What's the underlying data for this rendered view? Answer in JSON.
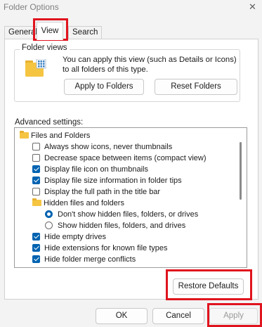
{
  "window": {
    "title": "Folder Options",
    "close_glyph": "✕"
  },
  "tabs": [
    "General",
    "View",
    "Search"
  ],
  "folder_views": {
    "label": "Folder views",
    "description": "You can apply this view (such as Details or Icons) to all folders of this type.",
    "apply_button": "Apply to Folders",
    "reset_button": "Reset Folders"
  },
  "advanced": {
    "label": "Advanced settings:",
    "rows": [
      {
        "type": "folder",
        "text": "Files and Folders"
      },
      {
        "type": "checkbox",
        "checked": false,
        "text": "Always show icons, never thumbnails"
      },
      {
        "type": "checkbox",
        "checked": false,
        "text": "Decrease space between items (compact view)"
      },
      {
        "type": "checkbox",
        "checked": true,
        "text": "Display file icon on thumbnails"
      },
      {
        "type": "checkbox",
        "checked": true,
        "text": "Display file size information in folder tips"
      },
      {
        "type": "checkbox",
        "checked": false,
        "text": "Display the full path in the title bar"
      },
      {
        "type": "folder",
        "text": "Hidden files and folders"
      },
      {
        "type": "radio",
        "checked": true,
        "text": "Don't show hidden files, folders, or drives"
      },
      {
        "type": "radio",
        "checked": false,
        "text": "Show hidden files, folders, and drives"
      },
      {
        "type": "checkbox",
        "checked": true,
        "text": "Hide empty drives"
      },
      {
        "type": "checkbox",
        "checked": true,
        "text": "Hide extensions for known file types"
      },
      {
        "type": "checkbox",
        "checked": true,
        "text": "Hide folder merge conflicts"
      }
    ]
  },
  "restore_button": "Restore Defaults",
  "footer": {
    "ok": "OK",
    "cancel": "Cancel",
    "apply": "Apply"
  },
  "colors": {
    "accent": "#0063b1",
    "highlight": "#e0141e"
  }
}
